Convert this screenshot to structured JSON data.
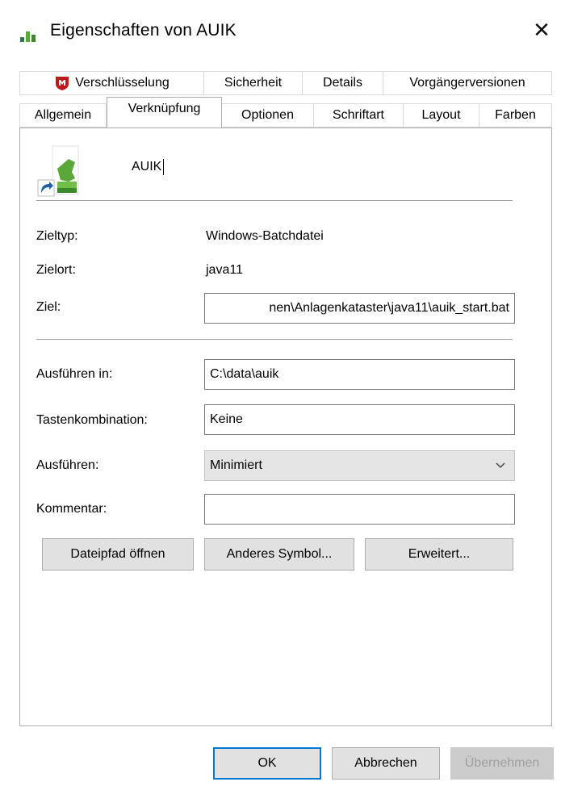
{
  "window": {
    "title": "Eigenschaften von AUIK",
    "close_glyph": "✕"
  },
  "tabs": {
    "row1": [
      {
        "label": "Verschlüsselung",
        "icon": "mcafee-shield-icon"
      },
      {
        "label": "Sicherheit"
      },
      {
        "label": "Details"
      },
      {
        "label": "Vorgängerversionen"
      }
    ],
    "row2": [
      {
        "label": "Allgemein"
      },
      {
        "label": "Verknüpfung",
        "active": true
      },
      {
        "label": "Optionen"
      },
      {
        "label": "Schriftart"
      },
      {
        "label": "Layout"
      },
      {
        "label": "Farben"
      }
    ]
  },
  "shortcut": {
    "name": "AUIK",
    "icon": "batch-file-shortcut-icon"
  },
  "fields": {
    "zieltyp_label": "Zieltyp:",
    "zieltyp_value": "Windows-Batchdatei",
    "zielort_label": "Zielort:",
    "zielort_value": "java11",
    "ziel_label": "Ziel:",
    "ziel_value": "nen\\Anlagenkataster\\java11\\auik_start.bat",
    "ausfuehren_in_label": "Ausführen in:",
    "ausfuehren_in_value": "C:\\data\\auik",
    "tastenkombination_label": "Tastenkombination:",
    "tastenkombination_value": "Keine",
    "ausfuehren_label": "Ausführen:",
    "ausfuehren_value": "Minimiert",
    "kommentar_label": "Kommentar:",
    "kommentar_value": ""
  },
  "buttons": {
    "dateipfad": "Dateipfad öffnen",
    "anderes_symbol": "Anderes Symbol...",
    "erweitert": "Erweitert...",
    "ok": "OK",
    "abbrechen": "Abbrechen",
    "uebernehmen": "Übernehmen"
  },
  "colors": {
    "accent": "#0078d7",
    "mcafee_red": "#c01818",
    "icon_green": "#3a8a2a"
  }
}
